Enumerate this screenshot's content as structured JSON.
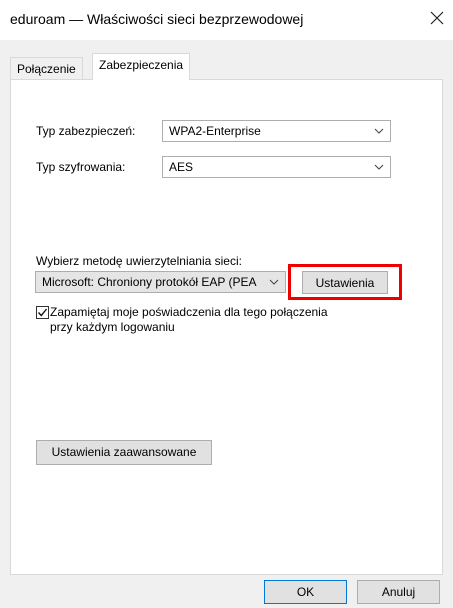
{
  "window": {
    "title": "eduroam — Właściwości sieci bezprzewodowej",
    "close_glyph": "✕"
  },
  "tabs": [
    {
      "label": "Połączenie",
      "active": false
    },
    {
      "label": "Zabezpieczenia",
      "active": true
    }
  ],
  "security": {
    "type_label": "Typ zabezpieczeń:",
    "type_value": "WPA2-Enterprise",
    "encryption_label": "Typ szyfrowania:",
    "encryption_value": "AES"
  },
  "auth": {
    "label": "Wybierz metodę uwierzytelniania sieci:",
    "method_value": "Microsoft: Chroniony protokół EAP (PEA",
    "settings_button": "Ustawienia",
    "remember_checkbox": {
      "checked": true,
      "label_line1": "Zapamiętaj moje poświadczenia dla tego połączenia",
      "label_line2": "przy każdym logowaniu"
    }
  },
  "advanced_button": "Ustawienia zaawansowane",
  "footer": {
    "ok_label": "OK",
    "cancel_label": "Anuluj"
  },
  "colors": {
    "highlight": "#ee0000",
    "default_button_border": "#0078d7"
  }
}
